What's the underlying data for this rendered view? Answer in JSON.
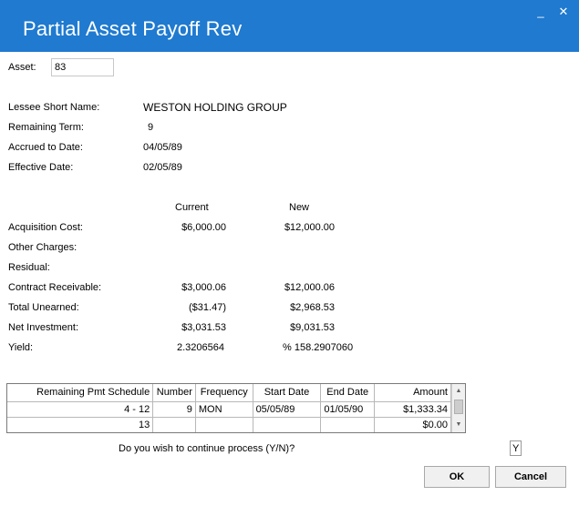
{
  "window": {
    "title": "Partial Asset Payoff Rev",
    "minimize_glyph": "_",
    "close_glyph": "✕"
  },
  "asset": {
    "label": "Asset:",
    "value": "83"
  },
  "info": {
    "lessee_label": "Lessee Short Name:",
    "lessee_value": "WESTON HOLDING GROUP",
    "remaining_term_label": "Remaining Term:",
    "remaining_term_value": "9",
    "accrued_label": "Accrued to Date:",
    "accrued_value": "04/05/89",
    "effective_label": "Effective Date:",
    "effective_value": "02/05/89"
  },
  "comparison": {
    "current_header": "Current",
    "new_header": "New",
    "rows": [
      {
        "label": "Acquisition Cost:",
        "current": "$6,000.00",
        "new": "$12,000.00"
      },
      {
        "label": "Other Charges:",
        "current": "",
        "new": ""
      },
      {
        "label": "Residual:",
        "current": "",
        "new": ""
      },
      {
        "label": "Contract Receivable:",
        "current": "$3,000.06",
        "new": "$12,000.06"
      },
      {
        "label": "Total Unearned:",
        "current": "($31.47)",
        "new": "$2,968.53"
      },
      {
        "label": "Net Investment:",
        "current": "$3,031.53",
        "new": "$9,031.53"
      },
      {
        "label": "Yield:",
        "current": "2.3206564",
        "new": "% 158.2907060"
      }
    ]
  },
  "schedule": {
    "headers": [
      "Remaining Pmt Schedule",
      "Number",
      "Frequency",
      "Start Date",
      "End Date",
      "Amount"
    ],
    "rows": [
      {
        "schedule": "4 - 12",
        "number": "9",
        "frequency": "MON",
        "start": "05/05/89",
        "end": "01/05/90",
        "amount": "$1,333.34"
      },
      {
        "schedule": "13",
        "number": "",
        "frequency": "",
        "start": "",
        "end": "",
        "amount": "$0.00"
      }
    ],
    "scroll_up_glyph": "▲",
    "scroll_down_glyph": "▼"
  },
  "prompt": {
    "text": "Do you wish to continue process (Y/N)?",
    "answer": "Y"
  },
  "buttons": {
    "ok": "OK",
    "cancel": "Cancel"
  }
}
